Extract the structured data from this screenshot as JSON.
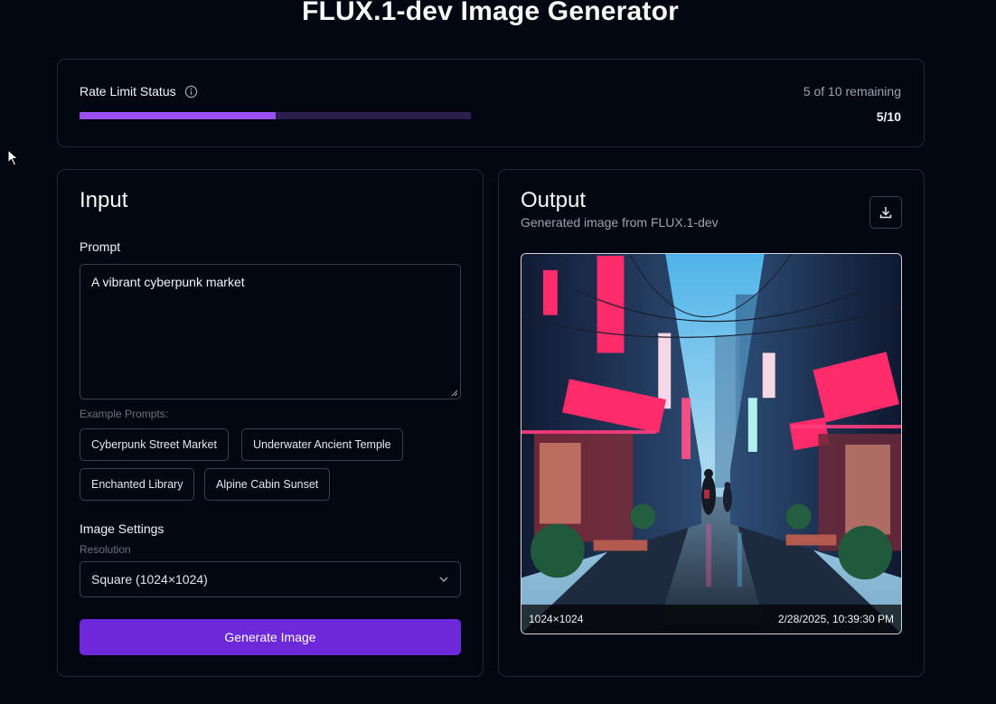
{
  "page": {
    "title": "FLUX.1-dev Image Generator"
  },
  "rate_limit": {
    "label": "Rate Limit Status",
    "remaining_text": "5 of 10 remaining",
    "count_text": "5/10",
    "used_fraction": 0.5,
    "bar_color": "#9c4ff0"
  },
  "input": {
    "title": "Input",
    "prompt_label": "Prompt",
    "prompt_value": "A vibrant cyberpunk market",
    "examples_label": "Example Prompts:",
    "examples": [
      "Cyberpunk Street Market",
      "Underwater Ancient Temple",
      "Enchanted Library",
      "Alpine Cabin Sunset"
    ],
    "settings_label": "Image Settings",
    "resolution_label": "Resolution",
    "resolution_value": "Square (1024×1024)",
    "generate_label": "Generate Image",
    "accent": "#6d28d9"
  },
  "output": {
    "title": "Output",
    "subtitle": "Generated image from FLUX.1-dev",
    "image_size": "1024×1024",
    "timestamp": "2/28/2025, 10:39:30 PM",
    "icons": {
      "download": "download-icon"
    }
  },
  "icons": {
    "info": "info-icon",
    "chevron": "chevron-down-icon",
    "cursor": "mouse-cursor-icon"
  }
}
